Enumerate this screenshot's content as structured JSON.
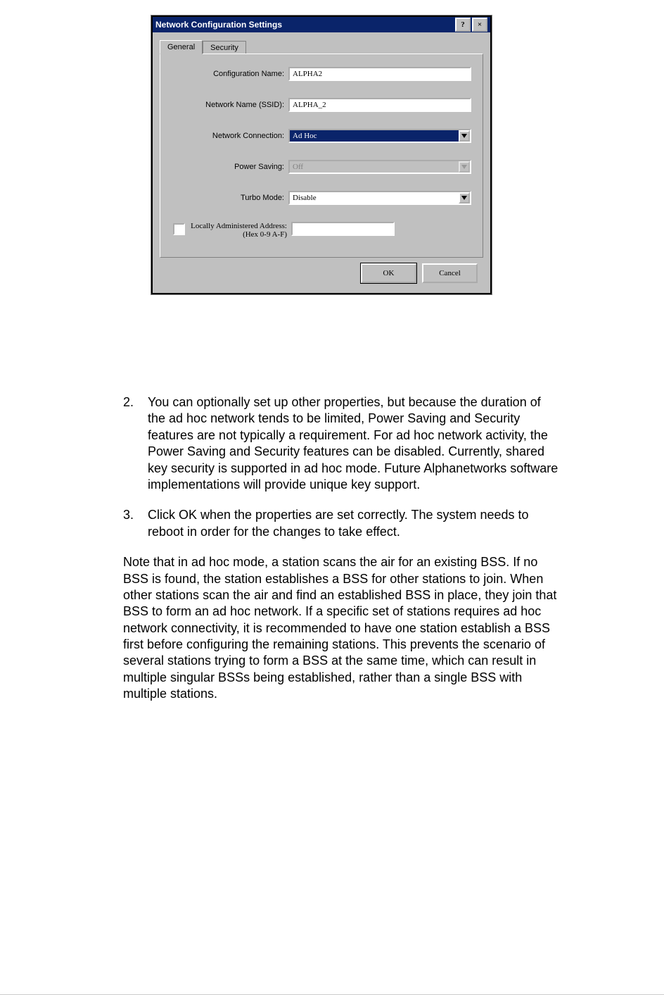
{
  "dialog": {
    "title": "Network Configuration Settings",
    "help_btn": "?",
    "close_btn": "×",
    "tabs": {
      "general": "General",
      "security": "Security"
    },
    "fields": {
      "config_name": {
        "label": "Configuration Name:",
        "value": "ALPHA2"
      },
      "ssid": {
        "label": "Network Name (SSID):",
        "value": "ALPHA_2"
      },
      "connection": {
        "label": "Network Connection:",
        "value": "Ad Hoc"
      },
      "power": {
        "label": "Power Saving:",
        "value": "Off"
      },
      "turbo": {
        "label": "Turbo Mode:",
        "value": "Disable"
      },
      "local_addr": {
        "label": "Locally Administered Address:\n(Hex 0-9 A-F)",
        "value": ""
      }
    },
    "buttons": {
      "ok": "OK",
      "cancel": "Cancel"
    }
  },
  "text": {
    "item2_num": "2.",
    "item2": "You can optionally set up other properties, but because the duration of the ad hoc network tends to be limited, Power Saving and Security features are not typically a requirement. For ad hoc network activity, the Power Saving and Security features can be disabled. Currently, shared key security is supported in ad hoc mode. Future Alphanetworks software implementations will provide unique key support.",
    "item3_num": "3.",
    "item3": "Click OK when the properties are set correctly. The system needs to reboot in order for the changes to take effect.",
    "note": "Note that in ad hoc mode, a station scans the air for an existing BSS. If no BSS is found, the station establishes a BSS for other stations to join. When other stations scan the air and find an established BSS in place, they join that BSS to form an ad hoc network. If a specific set of stations requires ad hoc network connectivity, it is recommended to have one station establish a BSS first before configuring the remaining stations. This prevents the scenario of several stations trying to form a BSS at the same time, which can result in multiple singular BSSs being established, rather than a single BSS with multiple stations."
  }
}
